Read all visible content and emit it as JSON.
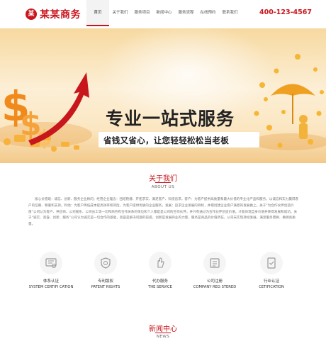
{
  "header": {
    "logo_mark": "某",
    "logo_text": "某某商务",
    "phone": "400-123-4567",
    "nav": [
      {
        "label": "首页",
        "active": true
      },
      {
        "label": "关于我们",
        "active": false
      },
      {
        "label": "服务项目",
        "active": false
      },
      {
        "label": "新闻中心",
        "active": false
      },
      {
        "label": "服务流程",
        "active": false
      },
      {
        "label": "在线预约",
        "active": false
      },
      {
        "label": "联系我们",
        "active": false
      }
    ]
  },
  "banner": {
    "title": "专业一站式服务",
    "subtitle": "省钱又省心，让您轻轻松松当老板",
    "slide_count": 2,
    "active_slide": 1
  },
  "about": {
    "title": "关于我们",
    "subtitle": "ABOUT US",
    "text": "核心价值观：诚信、创新、服务企业顾问；经营企业理念：团结稳健、开拓求实、满足客户、科技追求。客户：为客户提供高质量和最大价值的专业化产品和服务，以诚信和实力赢得客户的信赖、尊重和支持。利他：为客户降低成本提高效率和风险，为客户提供优质的企业服务，发展：追求企业发展的目标，并把创建企业客户满意的发展做上。关于“为合作伙伴创造价值”公司认为客户、供应商、公司股东、公司员工等一切和商务有合作关系的单位和个人都是是公司的合作伙伴，并只有通过为合作伙伴创造价值，才能体现自身价值并获得发展和成功。关于“诚实、宽容、创新、服务”公司认为诚实是一切合作的基础，宽容是解决问题的前提，创新是发展商业的力量，服务是商品的价值所在，公司未实现持续发展，满足服务需要、确保高质量。"
  },
  "services": [
    {
      "label": "体系认证",
      "en": "SYSTEM CERTIFI CATION",
      "icon": "certificate-icon"
    },
    {
      "label": "专利版权",
      "en": "PATENT RIGHTS",
      "icon": "patent-icon"
    },
    {
      "label": "代办服务",
      "en": "THE SERVICE",
      "icon": "hand-service-icon"
    },
    {
      "label": "公司注册",
      "en": "COMPANY REG STERED",
      "icon": "company-register-icon"
    },
    {
      "label": "行业认证",
      "en": "CETIFICATION",
      "icon": "industry-cert-icon"
    }
  ],
  "news": {
    "title": "新闻中心",
    "subtitle": "NEWS"
  },
  "colors": {
    "brand": "#c8161d",
    "banner_bg": "#fbe6c1"
  }
}
